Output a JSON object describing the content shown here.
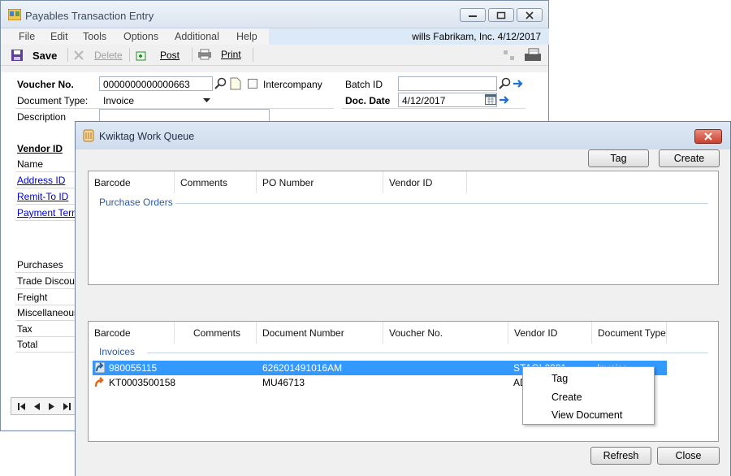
{
  "back_window": {
    "title": "Payables Transaction Entry",
    "menu": [
      "File",
      "Edit",
      "Tools",
      "Options",
      "Additional",
      "Help"
    ],
    "user_info": "wills  Fabrikam, Inc.  4/12/2017",
    "toolbar": {
      "save": "Save",
      "delete": "Delete",
      "post": "Post",
      "print": "Print"
    },
    "form": {
      "voucher_no_label": "Voucher No.",
      "voucher_no_value": "0000000000000663",
      "intercompany_label": "Intercompany",
      "batch_id_label": "Batch ID",
      "batch_id_value": "",
      "document_type_label": "Document Type:",
      "document_type_value": "Invoice",
      "doc_date_label": "Doc. Date",
      "doc_date_value": "4/12/2017",
      "description_label": "Description",
      "vendor_id_label": "Vendor ID",
      "name_label": "Name",
      "address_id_label": "Address ID",
      "remit_to_label": "Remit-To ID",
      "payment_terms_label": "Payment Term",
      "totals": [
        "Purchases",
        "Trade Discou",
        "Freight",
        "Miscellaneous",
        "Tax",
        "Total"
      ]
    }
  },
  "front_window": {
    "title": "Kwiktag Work Queue",
    "tag_button": "Tag",
    "create_button": "Create",
    "po_grid": {
      "headers": [
        "Barcode",
        "Comments",
        "PO Number",
        "Vendor ID"
      ],
      "group": "Purchase Orders"
    },
    "inv_grid": {
      "headers": [
        "Barcode",
        "Comments",
        "Document Number",
        "Voucher No.",
        "Vendor ID",
        "Document Type"
      ],
      "group": "Invoices",
      "rows": [
        {
          "barcode": "980055115",
          "document_number": "626201491016AM",
          "vendor_id": "STAGL0001",
          "document_type": "Invoice"
        },
        {
          "barcode": "KT0003500158",
          "document_number": "MU46713",
          "vendor_id": "AD",
          "document_type": ""
        }
      ]
    },
    "context_menu": [
      "Tag",
      "Create",
      "View Document"
    ],
    "refresh_button": "Refresh",
    "close_button": "Close"
  }
}
